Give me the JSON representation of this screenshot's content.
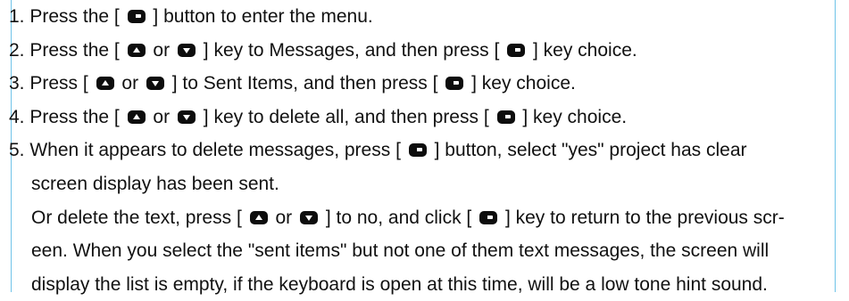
{
  "icons": {
    "menu_key": "menu-key-icon",
    "up_key": "up-arrow-key-icon",
    "down_key": "down-arrow-key-icon"
  },
  "colors": {
    "text": "#111111",
    "key_fill": "#0d0d0d",
    "guide_line": "#6fc3e8"
  },
  "steps": {
    "s1": {
      "a": "1. Press the [",
      "b": "] button to enter the menu."
    },
    "s2": {
      "a": "2. Press the [",
      "or": "or",
      "b": "] key to Messages, and then press [",
      "c": "] key choice."
    },
    "s3": {
      "a": "3. Press [",
      "or": "or",
      "b": "] to Sent Items, and then press [",
      "c": "] key choice."
    },
    "s4": {
      "a": "4. Press the [",
      "or": "or",
      "b": "] key to delete all, and then press [",
      "c": "] key choice."
    },
    "s5": {
      "a": "5. When it appears to delete messages, press [",
      "b": "] button, select \"yes\" project has clear",
      "line2": "screen display has been sent.",
      "line3_a": "Or delete the text, press [",
      "line3_or": "or",
      "line3_b": "] to no, and click [",
      "line3_c": "] key to return to the previous scr-",
      "line4": "een. When you select the \"sent items\" but not one of them text messages, the screen will",
      "line5": "display the list is empty, if the keyboard is open at this time, will be a low tone hint sound."
    }
  }
}
